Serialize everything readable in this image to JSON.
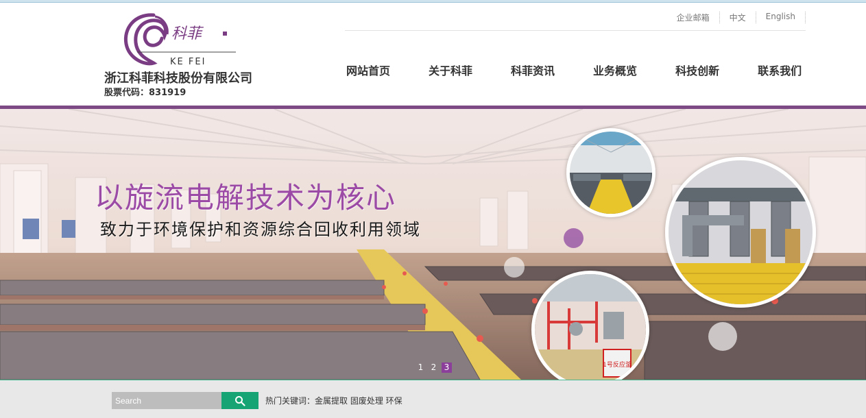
{
  "header": {
    "logo_text": "KE FEI",
    "logo_script": "科菲",
    "company_name": "浙江科菲科技股份有限公司",
    "stock_code": "股票代码：831919",
    "top_links": [
      "企业邮箱",
      "中文",
      "English"
    ],
    "nav": [
      "网站首页",
      "关于科菲",
      "科菲资讯",
      "业务概览",
      "科技创新",
      "联系我们"
    ]
  },
  "banner": {
    "headline": "以旋流电解技术为核心",
    "subline": "致力于环境保护和资源综合回收利用领域",
    "pager": [
      "1",
      "2",
      "3"
    ],
    "active_page": "3",
    "sign_text": "1号反应釜"
  },
  "search": {
    "placeholder": "Search",
    "hot_keywords": "热门关键词：金属提取 固废处理 环保"
  },
  "colors": {
    "brand_purple": "#7d4a85",
    "search_green": "#16a474"
  },
  "icons": [
    "search-icon"
  ]
}
